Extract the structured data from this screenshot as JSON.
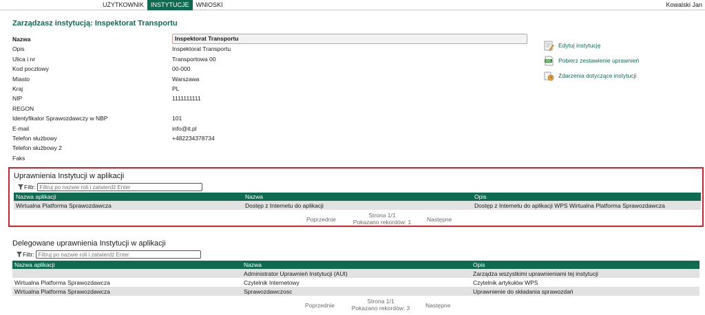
{
  "nav": {
    "items": [
      "UŻYTKOWNIK",
      "INSTYTUCJE",
      "WNIOSKI"
    ],
    "active_index": 1,
    "user": "Kowalski Jan"
  },
  "page_title": "Zarządzasz instytucją: Inspektorat Transportu",
  "details": [
    {
      "label": "Nazwa",
      "value": "Inspektorat Transportu"
    },
    {
      "label": "Opis",
      "value": "Inspektorat Transportu"
    },
    {
      "label": "Ulica i nr",
      "value": "Transportowa 00"
    },
    {
      "label": "Kod pocztowy",
      "value": "00-000"
    },
    {
      "label": "Miasto",
      "value": "Warszawa"
    },
    {
      "label": "Kraj",
      "value": "PL"
    },
    {
      "label": "NIP",
      "value": "1111111111"
    },
    {
      "label": "REGON",
      "value": ""
    },
    {
      "label": "Identyfikator Sprawozdawczy w NBP",
      "value": "101"
    },
    {
      "label": "E-mail",
      "value": "info@it.pl"
    },
    {
      "label": "Telefon służbowy",
      "value": "+482234378734"
    },
    {
      "label": "Telefon służbowy 2",
      "value": ""
    },
    {
      "label": "Faks",
      "value": ""
    }
  ],
  "actions": [
    {
      "label": "Edytuj instytucję",
      "icon": "edit-document-icon"
    },
    {
      "label": "Pobierz zestawienie uprawnień",
      "icon": "xml-file-icon"
    },
    {
      "label": "Zdarzenia dotyczące instytucji",
      "icon": "events-icon"
    }
  ],
  "section1": {
    "title": "Uprawnienia Instytucji w aplikacji",
    "filter_label": "Filtr:",
    "filter_placeholder": "Filtruj po nazwie roli i zatwierdź Enter",
    "columns": [
      "Nazwa aplikacji",
      "Nazwa",
      "Opis"
    ],
    "rows": [
      [
        "Wirtualna Platforma Sprawozdawcza",
        "Dostęp z Internetu do aplikacji",
        "Dostęp z Internetu do aplikacji WPS Wirtualna Platforma Sprawozdawcza"
      ]
    ],
    "pager": {
      "prev": "Poprzednie",
      "page": "Strona 1/1",
      "records": "Pokazano rekordów: 1",
      "next": "Następne"
    }
  },
  "section2": {
    "title": "Delegowane uprawnienia Instytucji w aplikacji",
    "filter_label": "Filtr:",
    "filter_placeholder": "Filtruj po nazwie roli i zatwierdź Enter",
    "columns": [
      "Nazwa aplikacji",
      "Nazwa",
      "Opis"
    ],
    "rows": [
      [
        "",
        "Administrator Uprawnień Instytucji (AUI)",
        "Zarządza wszystkimi uprawnieniami tej instytucji"
      ],
      [
        "Wirtualna Platforma Sprawozdawcza",
        "Czytelnik Internetowy",
        "Czytelnik artykułów WPS"
      ],
      [
        "Wirtualna Platforma Sprawozdawcza",
        "Sprawozdawczosc",
        "Uprawnienie do składania sprawozdań"
      ]
    ],
    "pager": {
      "prev": "Poprzednie",
      "page": "Strona 1/1",
      "records": "Pokazano rekordów: 3",
      "next": "Następne"
    }
  },
  "colors": {
    "accent": "#0e6b52",
    "highlight_border": "#d9202a",
    "row_alt": "#e2e2e2"
  }
}
